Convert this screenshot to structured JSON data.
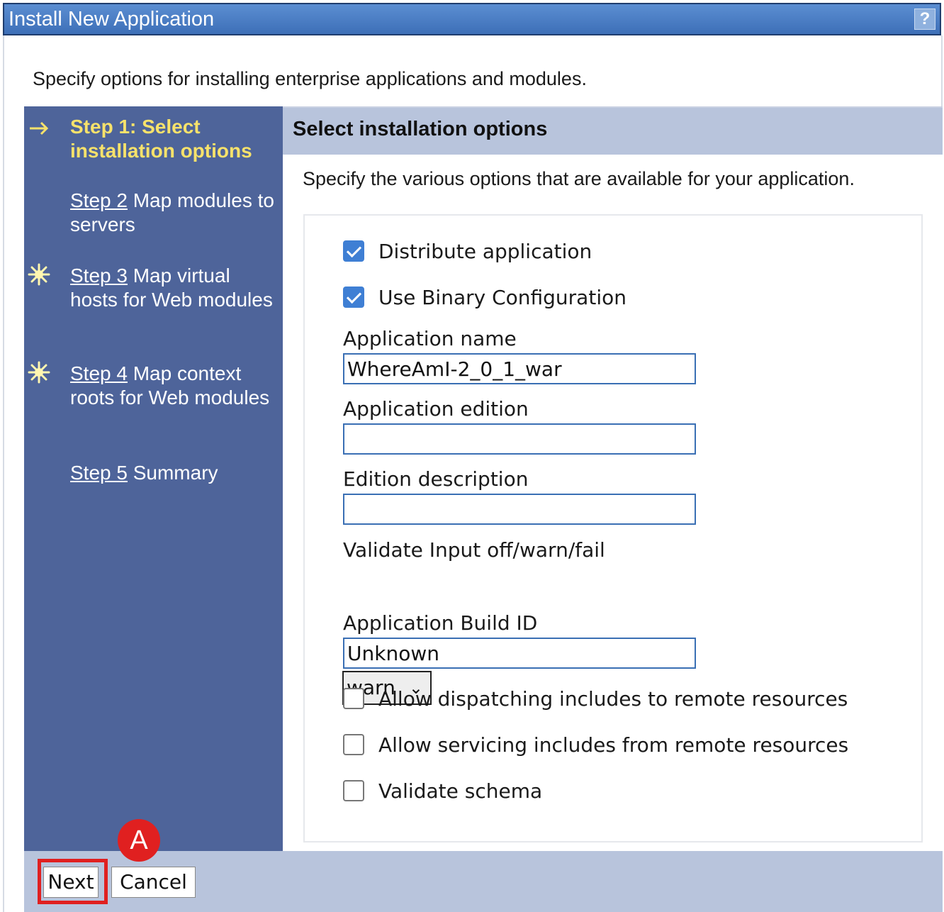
{
  "window": {
    "title": "Install New Application",
    "help_label": "?"
  },
  "intro_text": "Specify options for installing enterprise applications and modules.",
  "wizard_steps": [
    {
      "prefix": "Step 1: Select installation options",
      "rest": "",
      "status": "current",
      "icon": "arrow-right-icon"
    },
    {
      "prefix": "Step 2",
      "rest": " Map modules to servers",
      "status": "link",
      "icon": ""
    },
    {
      "prefix": "Step 3",
      "rest": " Map virtual hosts for Web modules",
      "status": "link",
      "icon": "starburst-icon"
    },
    {
      "prefix": "Step 4",
      "rest": " Map context roots for Web modules",
      "status": "link",
      "icon": "starburst-icon"
    },
    {
      "prefix": "Step 5",
      "rest": " Summary",
      "status": "link",
      "icon": ""
    }
  ],
  "panel": {
    "header": "Select installation options",
    "description": "Specify the various options that are available for your application."
  },
  "options": {
    "distribute": {
      "label": "Distribute application",
      "checked": true
    },
    "binary_config": {
      "label": "Use Binary Configuration",
      "checked": true
    },
    "app_name": {
      "label": "Application name",
      "value": "WhereAmI-2_0_1_war"
    },
    "app_edition": {
      "label": "Application edition",
      "value": ""
    },
    "edition_desc": {
      "label": "Edition description",
      "value": ""
    },
    "validate_input": {
      "label": "Validate Input off/warn/fail",
      "selected": "warn"
    },
    "build_id": {
      "label": "Application Build ID",
      "value": "Unknown"
    },
    "allow_dispatch": {
      "label": "Allow dispatching includes to remote resources",
      "checked": false
    },
    "allow_servicing": {
      "label": "Allow servicing includes from remote resources",
      "checked": false
    },
    "validate_schema": {
      "label": "Validate schema",
      "checked": false
    }
  },
  "buttons": {
    "next": "Next",
    "cancel": "Cancel"
  },
  "annotation": {
    "marker_label": "A",
    "color": "#e02020"
  }
}
